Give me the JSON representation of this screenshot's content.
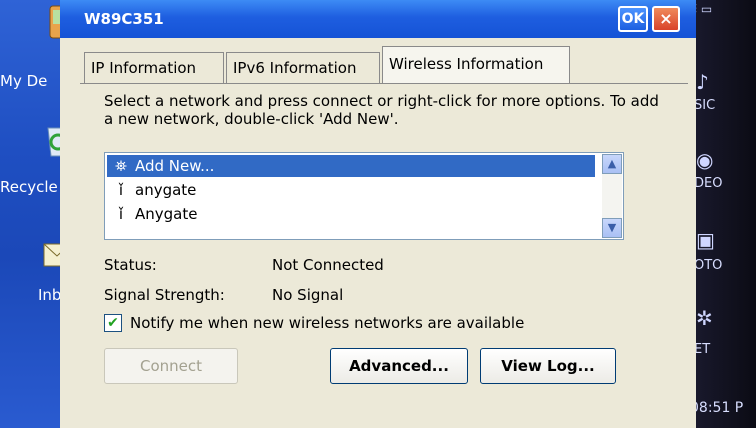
{
  "desktop": {
    "icons": [
      {
        "label": "My De",
        "icon": "pda-icon"
      },
      {
        "label": "Recycle",
        "icon": "recycle-bin-icon"
      },
      {
        "label": "Inbo",
        "icon": "inbox-icon"
      }
    ]
  },
  "rightbar": {
    "items": [
      {
        "label": "SIC",
        "icon": "music-icon"
      },
      {
        "label": "DEO",
        "icon": "video-icon"
      },
      {
        "label": "OTO",
        "icon": "photo-icon"
      },
      {
        "label": "ET",
        "icon": "settings-icon"
      }
    ],
    "time": "08:51 P"
  },
  "window": {
    "title": "W89C351",
    "ok_label": "OK",
    "close_label": "×"
  },
  "tabs": [
    {
      "label": "IP Information",
      "active": false
    },
    {
      "label": "IPv6 Information",
      "active": false
    },
    {
      "label": "Wireless Information",
      "active": true
    }
  ],
  "wireless": {
    "instructions": "Select a network and press connect or right-click for more options.  To add a new network, double-click 'Add New'.",
    "networks": [
      {
        "label": "Add New...",
        "selected": true,
        "icon": "add-network-icon"
      },
      {
        "label": "anygate",
        "selected": false,
        "icon": "access-point-icon"
      },
      {
        "label": "Anygate",
        "selected": false,
        "icon": "access-point-icon"
      }
    ],
    "status_label": "Status:",
    "status_value": "Not Connected",
    "signal_label": "Signal Strength:",
    "signal_value": "No Signal",
    "notify_checked": true,
    "notify_label": "Notify me when new wireless networks are available"
  },
  "buttons": {
    "connect": "Connect",
    "advanced": "Advanced...",
    "view_log": "View Log..."
  }
}
